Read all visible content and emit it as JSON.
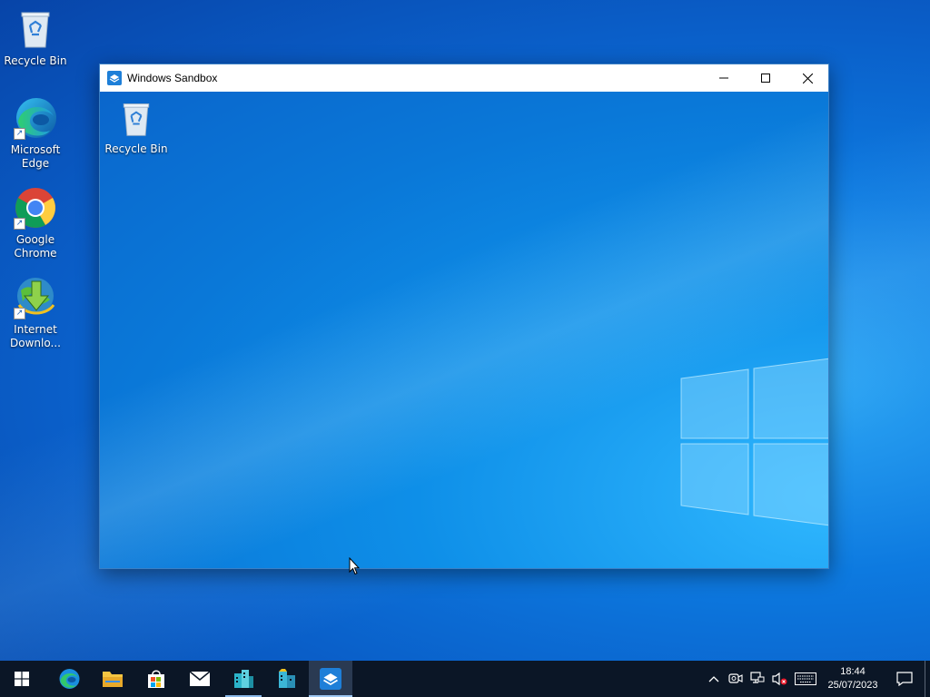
{
  "desktop": {
    "icons": [
      {
        "label": "Recycle Bin",
        "icon": "recycle-bin-icon"
      },
      {
        "label": "Microsoft Edge",
        "icon": "edge-icon"
      },
      {
        "label": "Google Chrome",
        "icon": "chrome-icon"
      },
      {
        "label": "Internet Downlo...",
        "icon": "idm-icon"
      }
    ]
  },
  "window": {
    "title": "Windows Sandbox",
    "icon": "sandbox-icon",
    "controls": {
      "minimize": "minimize-icon",
      "maximize": "maximize-icon",
      "close": "close-icon"
    },
    "inner_desktop": {
      "icons": [
        {
          "label": "Recycle Bin",
          "icon": "recycle-bin-icon"
        }
      ]
    }
  },
  "taskbar": {
    "buttons": [
      {
        "name": "start",
        "icon": "windows-start-icon"
      },
      {
        "name": "edge",
        "icon": "edge-icon"
      },
      {
        "name": "file-explorer",
        "icon": "folder-icon"
      },
      {
        "name": "store",
        "icon": "store-icon"
      },
      {
        "name": "mail",
        "icon": "mail-icon"
      },
      {
        "name": "app-1",
        "icon": "app-building-icon"
      },
      {
        "name": "app-2",
        "icon": "app-building-2-icon"
      },
      {
        "name": "windows-sandbox",
        "icon": "sandbox-icon"
      }
    ],
    "tray": {
      "icons": [
        "chevron-up-icon",
        "meet-now-icon",
        "network-icon",
        "volume-muted-icon",
        "keyboard-icon"
      ],
      "time": "18:44",
      "date": "25/07/2023"
    }
  },
  "colors": {
    "accent": "#0078d7",
    "taskbar": "#0b1626",
    "titlebar": "#ffffff"
  }
}
